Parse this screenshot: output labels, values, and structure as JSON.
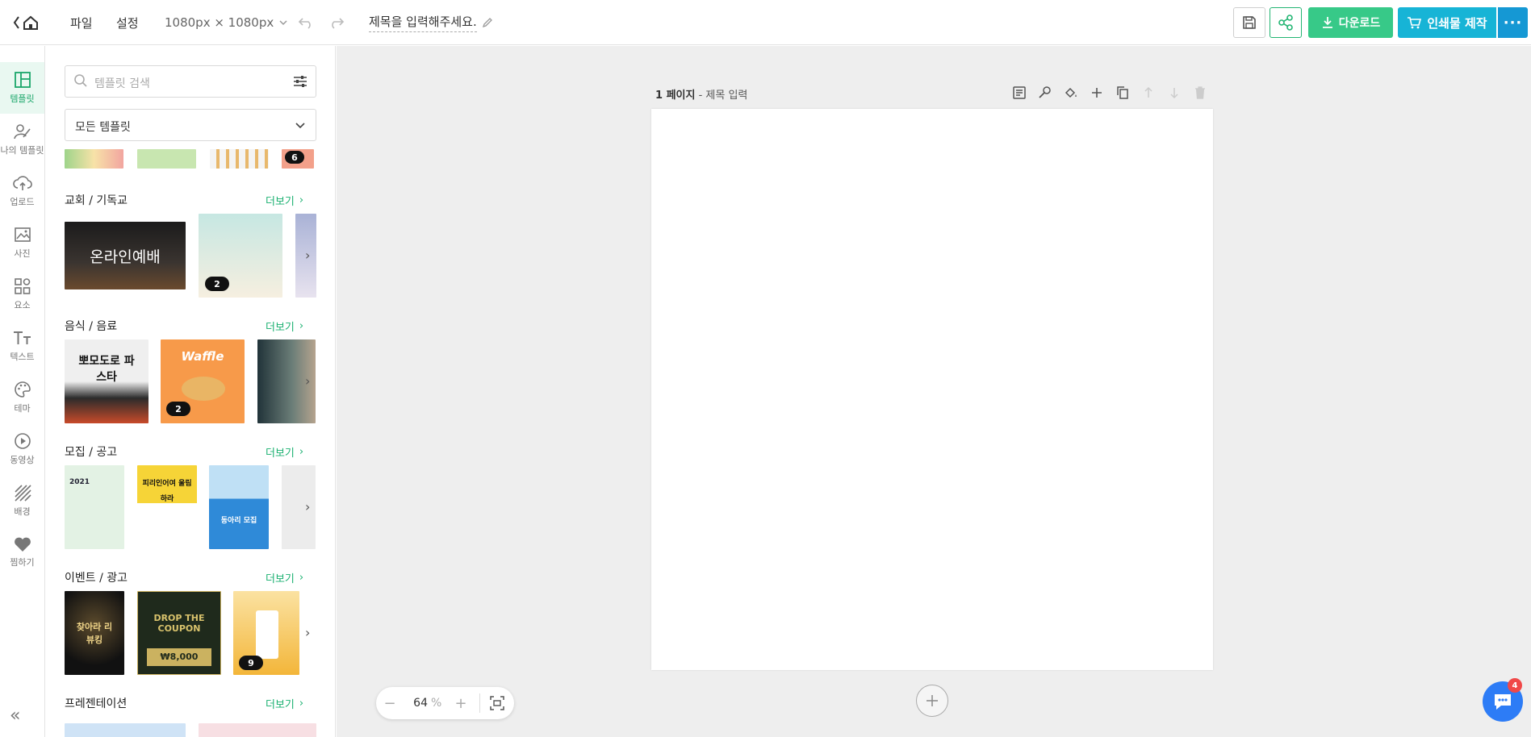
{
  "header": {
    "menu_file": "파일",
    "menu_settings": "설정",
    "canvas_size": "1080px × 1080px",
    "doc_title": "제목을 입력해주세요.",
    "download_label": "다운로드",
    "print_label": "인쇄물 제작",
    "more_label": "···"
  },
  "sidebar": {
    "items": [
      {
        "label": "템플릿",
        "icon": "template-icon",
        "active": true
      },
      {
        "label": "나의 템플릿",
        "icon": "my-template-icon"
      },
      {
        "label": "업로드",
        "icon": "upload-cloud-icon"
      },
      {
        "label": "사진",
        "icon": "photo-icon"
      },
      {
        "label": "요소",
        "icon": "elements-icon"
      },
      {
        "label": "텍스트",
        "icon": "text-icon"
      },
      {
        "label": "테마",
        "icon": "palette-icon"
      },
      {
        "label": "동영상",
        "icon": "video-icon"
      },
      {
        "label": "배경",
        "icon": "background-icon"
      },
      {
        "label": "찜하기",
        "icon": "heart-icon"
      }
    ],
    "collapse_label": "«"
  },
  "panel": {
    "search_placeholder": "템플릿 검색",
    "category_select": "모든 템플릿",
    "more_label": "더보기",
    "top_row_badge": "6",
    "sections": [
      {
        "title": "교회 / 기독교",
        "thumb1_text": "온라인예배",
        "badge": "2"
      },
      {
        "title": "음식 / 음료",
        "thumb1_text": "뽀모도로 파스타",
        "thumb2_text": "Waffle",
        "badge": "2"
      },
      {
        "title": "모집 / 공고",
        "thumb1_text": "2021",
        "thumb2_text": "피리인어여 울림하라",
        "thumb3_text": "동아리 모집"
      },
      {
        "title": "이벤트 / 광고",
        "thumb1_text": "찾아라 리뷰킹",
        "thumb2_text": "DROP THE COUPON",
        "thumb2_sub": "₩8,000",
        "badge": "9"
      },
      {
        "title": "프레젠테이션"
      }
    ]
  },
  "canvas": {
    "page_label": "1 페이지",
    "page_title_placeholder": "- 제목 입력",
    "zoom_value": "64",
    "zoom_unit": "%",
    "chat_badge": "4"
  },
  "colors": {
    "accent_green": "#37c988",
    "accent_blue": "#17b4d6",
    "active_nav": "#1aa66a"
  }
}
